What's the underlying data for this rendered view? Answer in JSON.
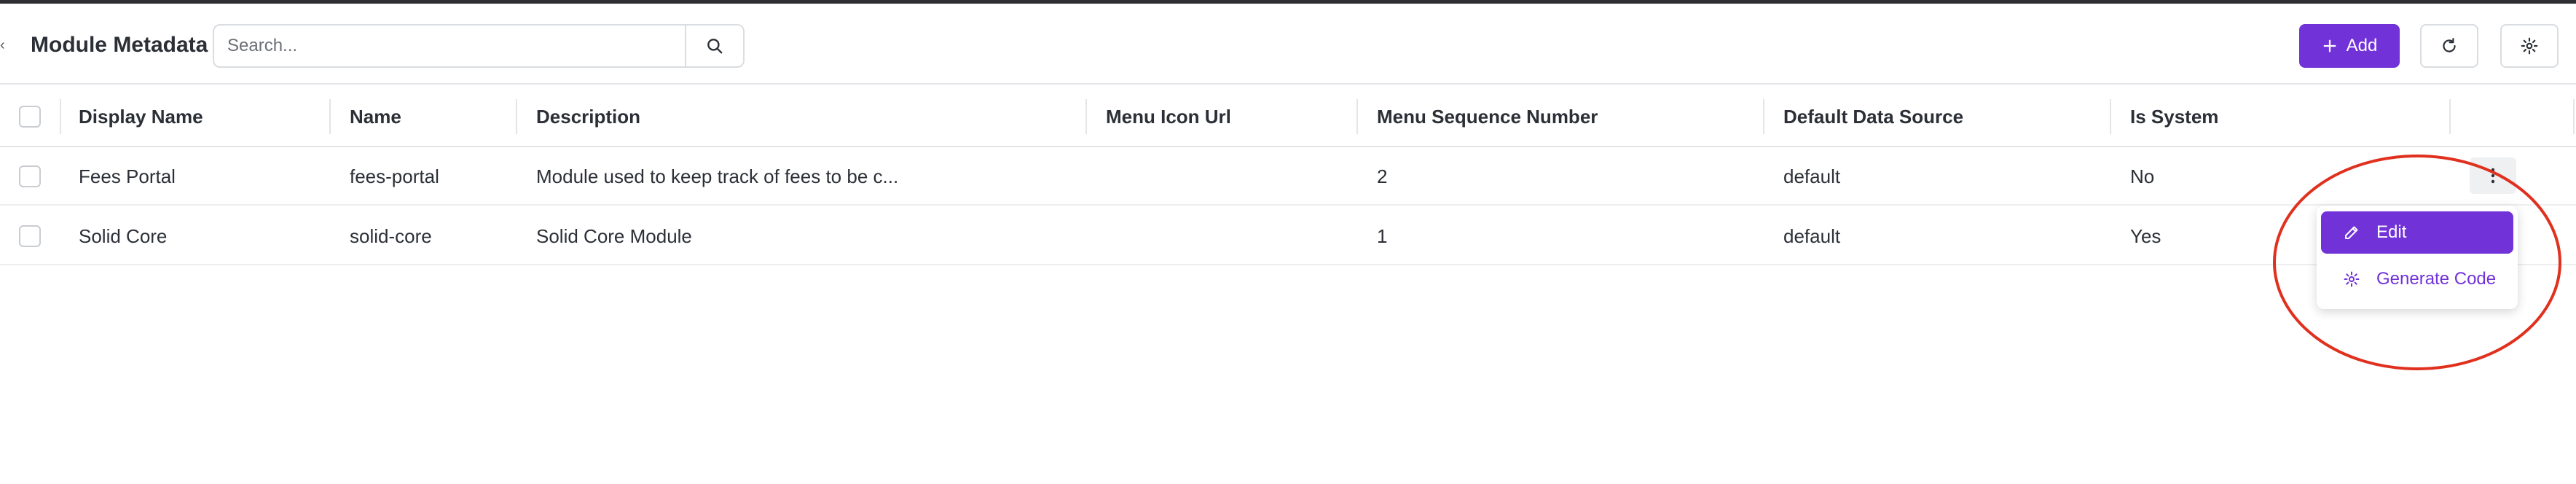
{
  "header": {
    "title": "Module Metadata",
    "collapse_glyph": "‹",
    "search": {
      "placeholder": "Search...",
      "value": ""
    },
    "add_label": "Add"
  },
  "table": {
    "columns": [
      "Display Name",
      "Name",
      "Description",
      "Menu Icon Url",
      "Menu Sequence Number",
      "Default Data Source",
      "Is System"
    ],
    "rows": [
      {
        "display_name": "Fees Portal",
        "name": "fees-portal",
        "description": "Module used to keep track of fees to be c...",
        "menu_icon_url": "",
        "menu_sequence_number": "2",
        "default_data_source": "default",
        "is_system": "No"
      },
      {
        "display_name": "Solid Core",
        "name": "solid-core",
        "description": "Solid Core Module",
        "menu_icon_url": "",
        "menu_sequence_number": "1",
        "default_data_source": "default",
        "is_system": "Yes"
      }
    ]
  },
  "row_menu": {
    "items": [
      {
        "label": "Edit",
        "icon": "pencil-icon"
      },
      {
        "label": "Generate Code",
        "icon": "gear-icon"
      }
    ]
  },
  "colors": {
    "accent": "#7132d8",
    "annotation": "#e0301e",
    "border": "#e3e5e8",
    "text": "#2b2f36"
  },
  "icons": [
    "search-icon",
    "plus-icon",
    "refresh-icon",
    "gear-icon",
    "kebab-icon",
    "pencil-icon",
    "chevron-left-icon"
  ]
}
